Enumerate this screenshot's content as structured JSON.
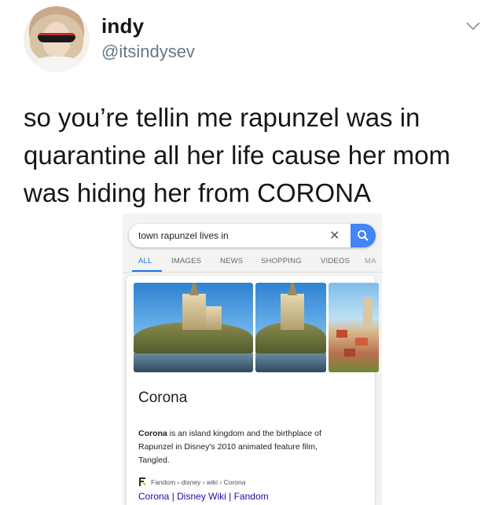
{
  "tweet": {
    "name": "indy",
    "handle": "@itsindysev",
    "text": "so you’re tellin me rapunzel was in quarantine all her life cause her mom was hiding her from CORONA",
    "menu_icon": "chevron-down-icon"
  },
  "search": {
    "query": "town rapunzel lives in",
    "clear_icon": "close-icon",
    "search_icon": "search-icon",
    "button_color": "#4285f4"
  },
  "tabs": [
    {
      "label": "ALL",
      "active": true
    },
    {
      "label": "IMAGES"
    },
    {
      "label": "NEWS"
    },
    {
      "label": "SHOPPING"
    },
    {
      "label": "VIDEOS"
    },
    {
      "label": "MA"
    }
  ],
  "result": {
    "title": "Corona",
    "description_bold": "Corona",
    "description_rest": " is an island kingdom and the birthplace of Rapunzel in Disney's 2010 animated feature film, Tangled.",
    "source": "Fandom › disney › wiki › Corona",
    "link": "Corona | Disney Wiki | Fandom"
  },
  "colors": {
    "accent": "#1a73e8",
    "link": "#1a0dab",
    "handle": "#657786"
  }
}
